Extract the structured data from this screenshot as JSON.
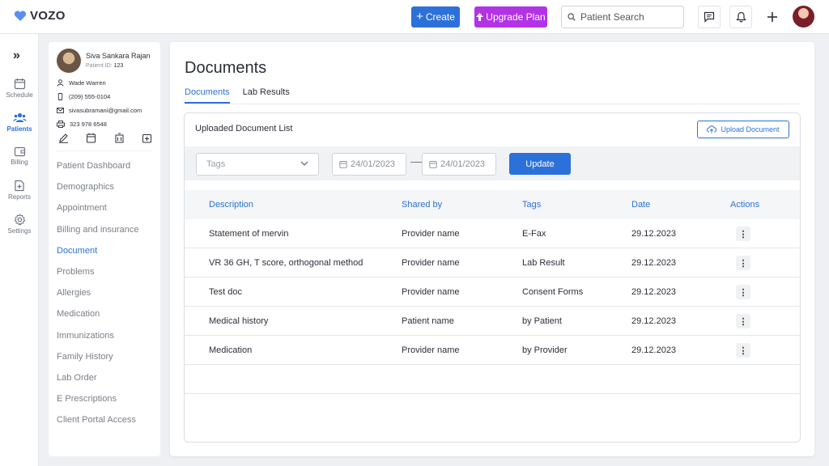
{
  "app": {
    "logo_text": "VOZO",
    "create_label": "Create",
    "upgrade_label": "Upgrade Plan",
    "search_placeholder": "Patient Search"
  },
  "rail": {
    "items": [
      {
        "label": "Schedule",
        "icon": "calendar-icon"
      },
      {
        "label": "Patients",
        "icon": "users-icon",
        "active": true
      },
      {
        "label": "Billing",
        "icon": "wallet-icon"
      },
      {
        "label": "Reports",
        "icon": "report-icon"
      },
      {
        "label": "Settings",
        "icon": "gear-icon"
      }
    ]
  },
  "patient": {
    "name": "Siva Sankara Rajan",
    "id_label": "Patient ID:",
    "id_value": "123",
    "contact_name": "Wade Warren",
    "phone": "(209) 555-0104",
    "email": "sivasubramani@gmail.com",
    "fax": "323 978 6548",
    "menu": [
      "Patient Dashboard",
      "Demographics",
      "Appointment",
      "Billing and insurance",
      "Document",
      "Problems",
      "Allergies",
      "Medication",
      "Immunizations",
      "Family History",
      "Lab Order",
      "E Prescriptions",
      "Client Portal Access"
    ],
    "active_menu_index": 4
  },
  "main": {
    "title": "Documents",
    "tabs": [
      {
        "label": "Documents",
        "active": true
      },
      {
        "label": "Lab Results",
        "active": false
      }
    ],
    "list_title": "Uploaded Document List",
    "upload_label": "Upload Document",
    "filters": {
      "tags_placeholder": "Tags",
      "date_from": "24/01/2023",
      "date_to": "24/01/2023",
      "update_label": "Update"
    },
    "table": {
      "columns": [
        "Description",
        "Shared by",
        "Tags",
        "Date",
        "Actions"
      ],
      "rows": [
        {
          "description": "Statement of mervin",
          "shared_by": "Provider name",
          "tags": "E-Fax",
          "date": "29.12.2023"
        },
        {
          "description": "VR 36 GH, T score, orthogonal method",
          "shared_by": "Provider name",
          "tags": "Lab Result",
          "date": "29.12.2023"
        },
        {
          "description": "Test doc",
          "shared_by": "Provider name",
          "tags": "Consent Forms",
          "date": "29.12.2023"
        },
        {
          "description": "Medical history",
          "shared_by": "Patient name",
          "tags": "by Patient",
          "date": "29.12.2023"
        },
        {
          "description": "Medication",
          "shared_by": "Provider name",
          "tags": "by Provider",
          "date": "29.12.2023"
        }
      ]
    }
  },
  "colors": {
    "accent": "#2c71d9",
    "upgrade": "#b232e6"
  }
}
